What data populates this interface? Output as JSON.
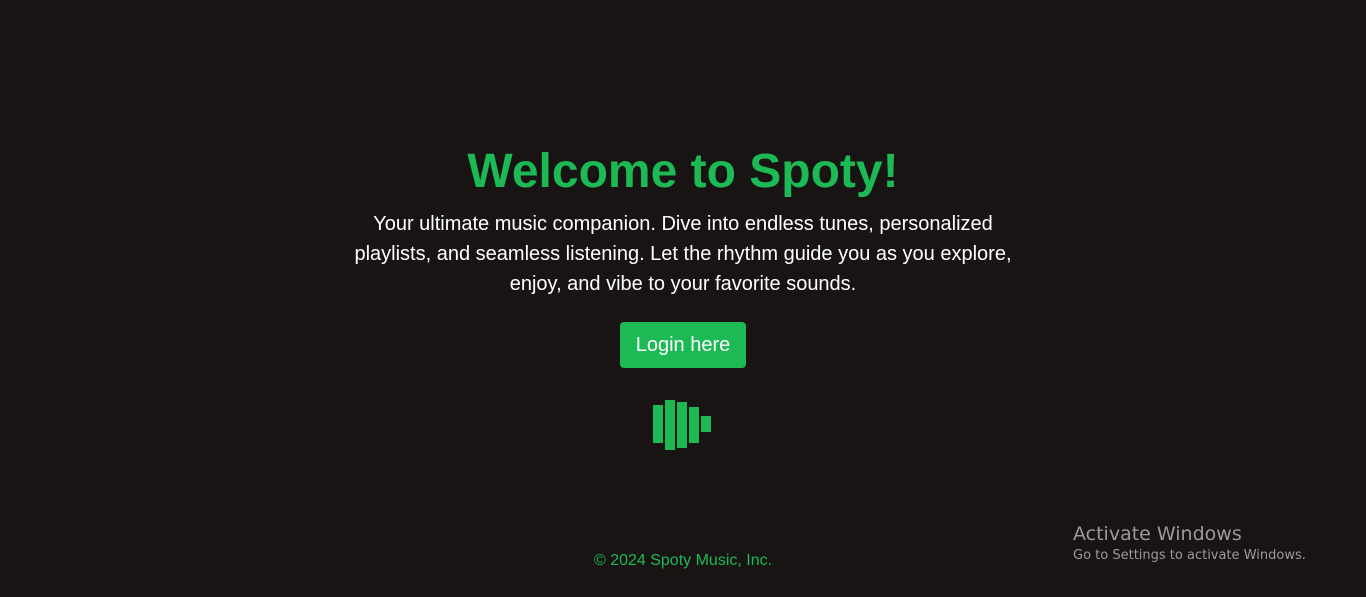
{
  "hero": {
    "title": "Welcome to Spoty!",
    "tagline": "Your ultimate music companion. Dive into endless tunes, personalized playlists, and seamless listening. Let the rhythm guide you as you explore, enjoy, and vibe to your favorite sounds.",
    "login_label": "Login here"
  },
  "footer": {
    "copyright": "© 2024 Spoty Music, Inc."
  },
  "windows_watermark": {
    "title": "Activate Windows",
    "subtitle": "Go to Settings to activate Windows."
  },
  "colors": {
    "background": "#181414",
    "accent": "#1db954",
    "text": "#ffffff"
  },
  "icons": {
    "logo": "equalizer-bars-icon"
  }
}
